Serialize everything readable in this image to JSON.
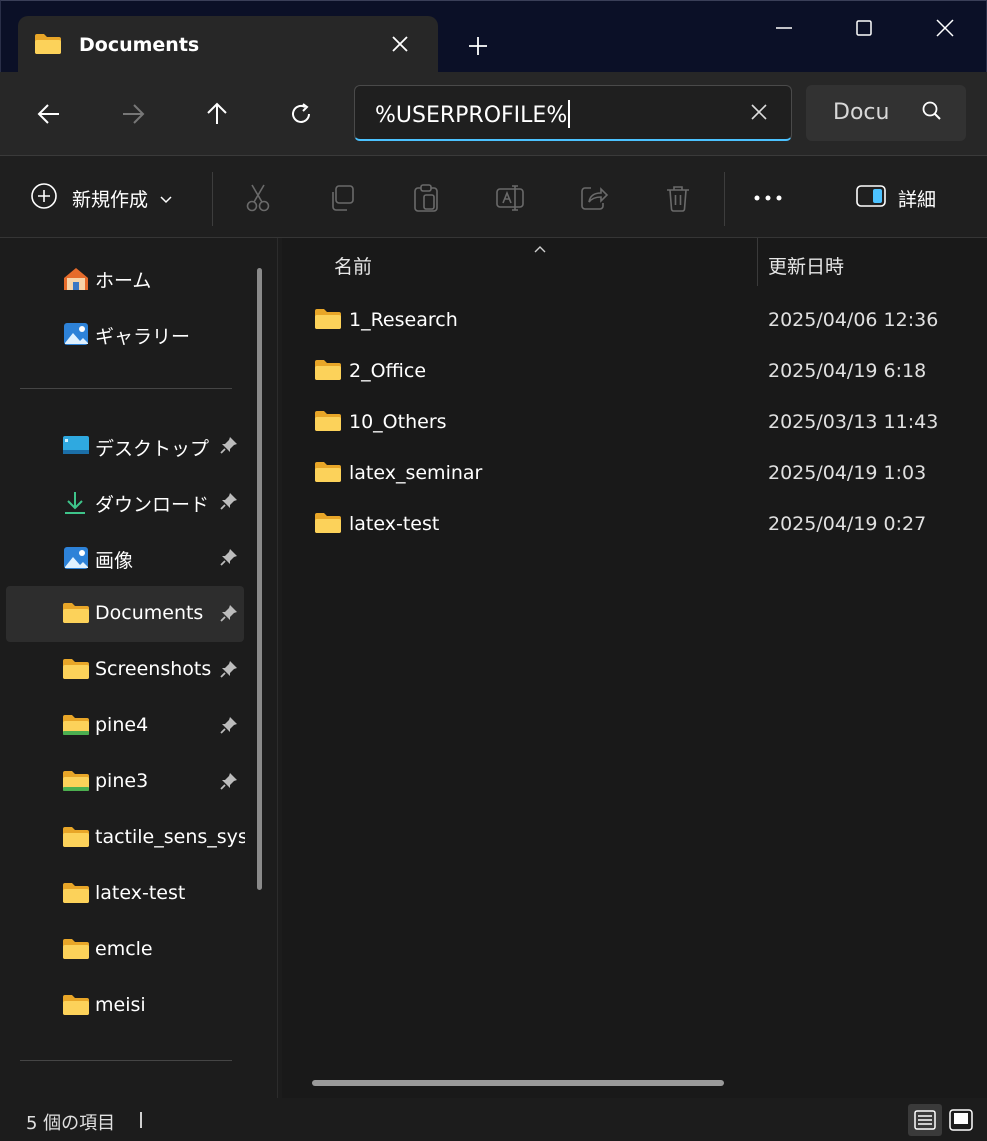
{
  "window": {
    "tab_title": "Documents",
    "controls": [
      "minimize",
      "maximize",
      "close"
    ]
  },
  "navigation": {
    "address_value": "%USERPROFILE%",
    "search_value": "Docu"
  },
  "toolbar": {
    "new_label": "新規作成",
    "details_label": "詳細",
    "icons": [
      "cut-icon",
      "copy-icon",
      "paste-icon",
      "rename-icon",
      "share-icon",
      "delete-icon"
    ]
  },
  "sidebar": {
    "top_items": [
      {
        "label": "ホーム",
        "icon": "home-icon"
      },
      {
        "label": "ギャラリー",
        "icon": "gallery-icon"
      }
    ],
    "quick_access": [
      {
        "label": "デスクトップ",
        "icon": "desktop-icon",
        "pinned": true
      },
      {
        "label": "ダウンロード",
        "icon": "download-icon",
        "pinned": true
      },
      {
        "label": "画像",
        "icon": "pictures-icon",
        "pinned": true
      },
      {
        "label": "Documents",
        "icon": "folder-icon",
        "pinned": true,
        "selected": true
      },
      {
        "label": "Screenshots",
        "icon": "folder-icon",
        "pinned": true
      },
      {
        "label": "pine4",
        "icon": "folder-green-icon",
        "pinned": true
      },
      {
        "label": "pine3",
        "icon": "folder-green-icon",
        "pinned": true
      },
      {
        "label": "tactile_sens_syst",
        "icon": "folder-icon",
        "pinned": false
      },
      {
        "label": "latex-test",
        "icon": "folder-icon",
        "pinned": false
      },
      {
        "label": "emcle",
        "icon": "folder-icon",
        "pinned": false
      },
      {
        "label": "meisi",
        "icon": "folder-icon",
        "pinned": false
      }
    ]
  },
  "content": {
    "columns": {
      "name": "名前",
      "date": "更新日時"
    },
    "rows": [
      {
        "name": "1_Research",
        "date": "2025/04/06 12:36"
      },
      {
        "name": "2_Office",
        "date": "2025/04/19 6:18"
      },
      {
        "name": "10_Others",
        "date": "2025/03/13 11:43"
      },
      {
        "name": "latex_seminar",
        "date": "2025/04/19 1:03"
      },
      {
        "name": "latex-test",
        "date": "2025/04/19 0:27"
      }
    ]
  },
  "status": {
    "item_count": "5 個の項目"
  },
  "colors": {
    "accent": "#4cc2ff",
    "folder": "#f8c645",
    "background": "#1c1c1c"
  }
}
